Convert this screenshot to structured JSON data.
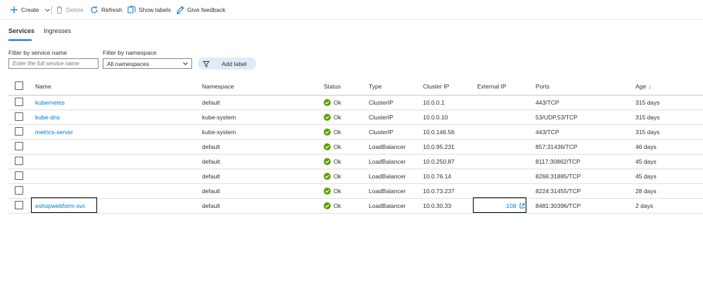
{
  "toolbar": {
    "create_label": "Create",
    "delete_label": "Delete",
    "refresh_label": "Refresh",
    "show_labels_label": "Show labels",
    "feedback_label": "Give feedback"
  },
  "tabs": [
    {
      "label": "Services",
      "selected": true
    },
    {
      "label": "Ingresses",
      "selected": false
    }
  ],
  "filters": {
    "service_name_label": "Filter by service name",
    "service_name_placeholder": "Enter the full service name",
    "service_name_value": "",
    "namespace_label": "Filter by namespace",
    "namespace_value": "All namespaces",
    "add_label_button": "Add label"
  },
  "table": {
    "columns": [
      "Name",
      "Namespace",
      "Status",
      "Type",
      "Cluster IP",
      "External IP",
      "Ports",
      "Age"
    ],
    "sort_indicator": "↓",
    "rows": [
      {
        "name": "kubernetes",
        "namespace": "default",
        "status": "Ok",
        "type": "ClusterIP",
        "cluster_ip": "10.0.0.1",
        "external_ip": "",
        "ports": "443/TCP",
        "age": "315 days"
      },
      {
        "name": "kube-dns",
        "namespace": "kube-system",
        "status": "Ok",
        "type": "ClusterIP",
        "cluster_ip": "10.0.0.10",
        "external_ip": "",
        "ports": "53/UDP,53/TCP",
        "age": "315 days"
      },
      {
        "name": "metrics-server",
        "namespace": "kube-system",
        "status": "Ok",
        "type": "ClusterIP",
        "cluster_ip": "10.0.146.56",
        "external_ip": "",
        "ports": "443/TCP",
        "age": "315 days"
      },
      {
        "name": "",
        "namespace": "default",
        "status": "Ok",
        "type": "LoadBalancer",
        "cluster_ip": "10.0.95.231",
        "external_ip": "",
        "ports": "857:31436/TCP",
        "age": "46 days"
      },
      {
        "name": "",
        "namespace": "default",
        "status": "Ok",
        "type": "LoadBalancer",
        "cluster_ip": "10.0.250.87",
        "external_ip": "",
        "ports": "8117:30862/TCP",
        "age": "45 days"
      },
      {
        "name": "",
        "namespace": "default",
        "status": "Ok",
        "type": "LoadBalancer",
        "cluster_ip": "10.0.76.14",
        "external_ip": "",
        "ports": "8266:31885/TCP",
        "age": "45 days"
      },
      {
        "name": "",
        "namespace": "default",
        "status": "Ok",
        "type": "LoadBalancer",
        "cluster_ip": "10.0.73.237",
        "external_ip": "",
        "ports": "8224:31455/TCP",
        "age": "28 days"
      },
      {
        "name": "eshopwebform-svc",
        "namespace": "default",
        "status": "Ok",
        "type": "LoadBalancer",
        "cluster_ip": "10.0.30.33",
        "external_ip": ".108",
        "ports": "8481:30396/TCP",
        "age": "2 days"
      }
    ]
  },
  "colors": {
    "accent": "#0078d4",
    "ok_green": "#57a300",
    "add_label_bg": "#deecf9"
  },
  "icons": {
    "create": "plus-icon",
    "delete": "trash-icon",
    "refresh": "refresh-icon",
    "show_labels": "labels-icon",
    "feedback": "feedback-icon",
    "namespace_dropdown": "chevron-down-icon",
    "add_label": "filter-icon",
    "status": "check-circle-icon",
    "external_link": "external-link-icon",
    "sort": "sort-down-icon"
  }
}
